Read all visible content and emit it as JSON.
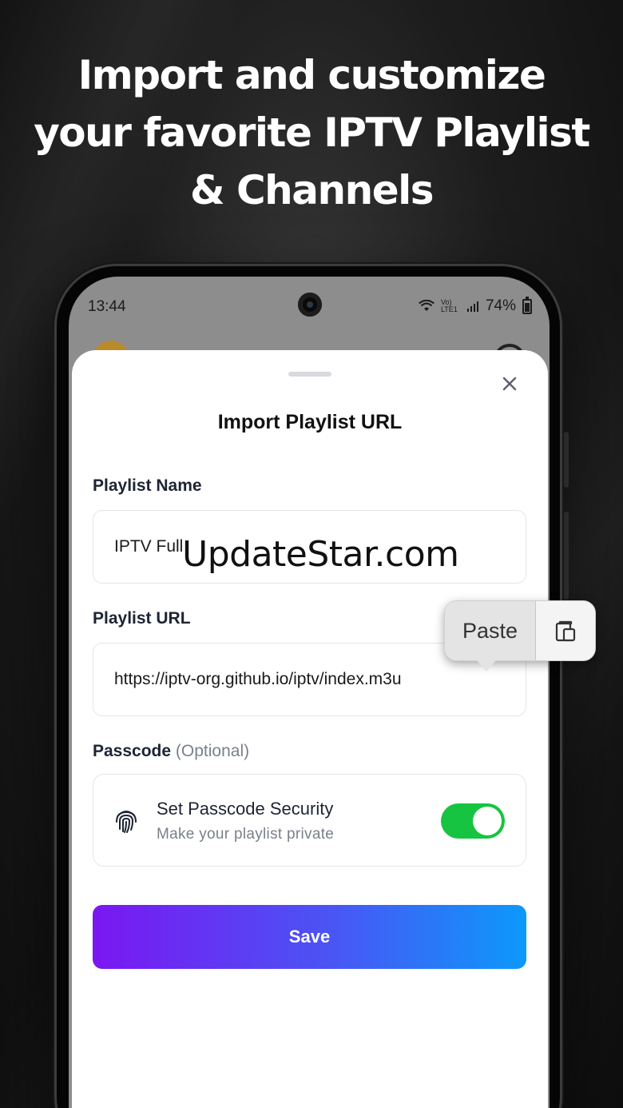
{
  "headline": {
    "line1": "Import and customize",
    "line2": "your favorite IPTV Playlist",
    "line3": "& Channels"
  },
  "status_bar": {
    "time": "13:44",
    "network_label": "Vo) LTE1",
    "battery": "74%"
  },
  "sheet": {
    "title": "Import Playlist URL",
    "close_icon": "close-icon",
    "playlist_name": {
      "label": "Playlist Name",
      "value": "IPTV Full"
    },
    "playlist_url": {
      "label": "Playlist URL",
      "value": "https://iptv-org.github.io/iptv/index.m3u"
    },
    "passcode": {
      "label": "Passcode",
      "optional": "(Optional)",
      "title": "Set Passcode Security",
      "subtitle": "Make your playlist private",
      "enabled": true,
      "icon": "fingerprint-icon"
    },
    "save_label": "Save"
  },
  "paste_popup": {
    "label": "Paste",
    "icon": "clipboard-icon"
  },
  "watermark": "UpdateStar.com",
  "colors": {
    "toggle_on": "#17c441",
    "save_gradient_start": "#7a17f2",
    "save_gradient_end": "#0c99fb"
  }
}
